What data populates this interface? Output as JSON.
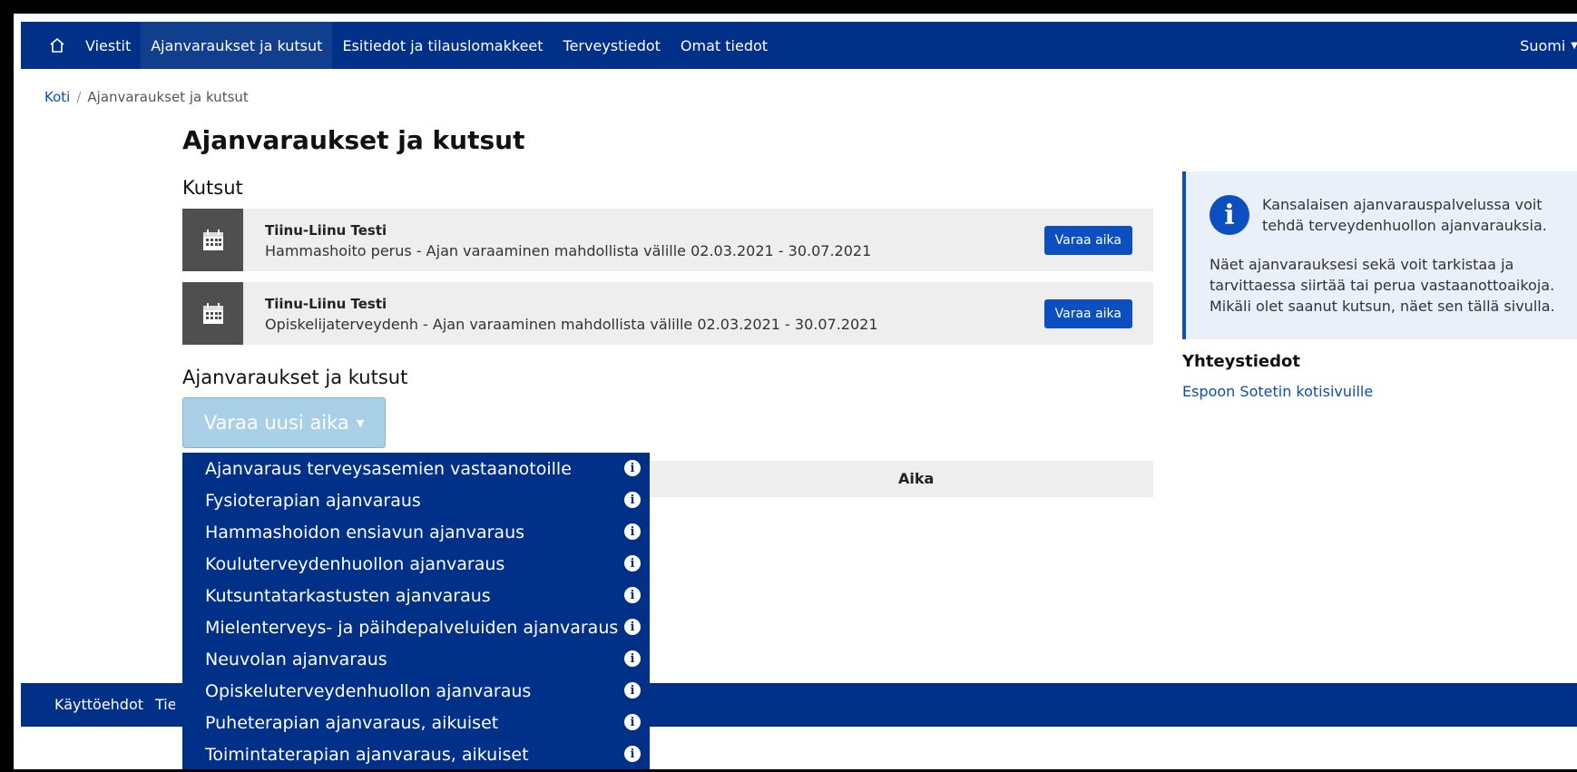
{
  "nav": {
    "items": [
      "Viestit",
      "Ajanvaraukset ja kutsut",
      "Esitiedot ja tilauslomakkeet",
      "Terveystiedot",
      "Omat tiedot"
    ],
    "language": "Suomi"
  },
  "breadcrumb": {
    "home": "Koti",
    "separator": "/",
    "current": "Ajanvaraukset ja kutsut"
  },
  "page_title": "Ajanvaraukset ja kutsut",
  "invitations": {
    "heading": "Kutsut",
    "items": [
      {
        "name": "Tiinu-Liinu Testi",
        "description": "Hammashoito perus - Ajan varaaminen mahdollista välille 02.03.2021 - 30.07.2021",
        "button": "Varaa aika"
      },
      {
        "name": "Tiinu-Liinu Testi",
        "description": "Opiskelijaterveydenh - Ajan varaaminen mahdollista välille 02.03.2021 - 30.07.2021",
        "button": "Varaa aika"
      }
    ]
  },
  "appointments": {
    "heading": "Ajanvaraukset ja kutsut",
    "new_button": "Varaa uusi aika",
    "table_column": "Aika"
  },
  "dropdown": {
    "options": [
      "Ajanvaraus terveysasemien vastaanotoille",
      "Fysioterapian ajanvaraus",
      "Hammashoidon ensiavun ajanvaraus",
      "Kouluterveydenhuollon ajanvaraus",
      "Kutsuntatarkastusten ajanvaraus",
      "Mielenterveys- ja päihdepalveluiden ajanvaraus",
      "Neuvolan ajanvaraus",
      "Opiskeluterveydenhuollon ajanvaraus",
      "Puheterapian ajanvaraus, aikuiset",
      "Toimintaterapian ajanvaraus, aikuiset"
    ]
  },
  "info": {
    "text1": "Kansalaisen ajanvarauspalvelussa voit tehdä terveydenhuollon ajanvarauksia.",
    "text2": "Näet ajanvarauksesi sekä voit tarkistaa ja tarvittaessa siirtää tai perua vastaanottoaikoja. Mikäli olet saanut kutsun, näet sen tällä sivulla."
  },
  "contact": {
    "heading": "Yhteystiedot",
    "link": "Espoon Sotetin kotisivuille"
  },
  "footer": {
    "item1": "Käyttöehdot",
    "item2": "Tietosuoja"
  },
  "colors": {
    "nav": "#003087",
    "button": "#0b4fc0",
    "new_button": "#a9d0e6"
  }
}
